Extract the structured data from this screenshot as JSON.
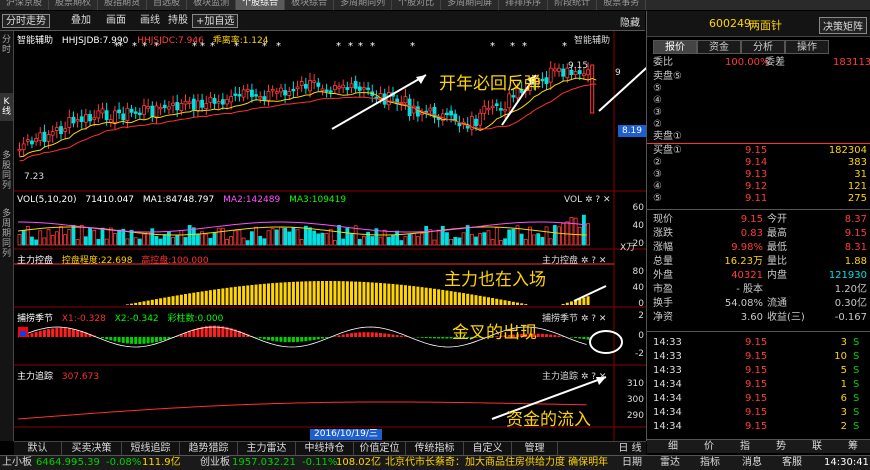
{
  "topnav": [
    "沪深京股",
    "股票期权",
    "股指期货",
    "自选股",
    "板块监测",
    "个股综合",
    "板块综合",
    "多周期同列",
    "个股对比",
    "多周期同屏",
    "排排序序",
    "阶段统计",
    "股票事务"
  ],
  "topnav_active": 5,
  "toolbar": {
    "items": [
      "分时走势",
      "叠加",
      "画面",
      "画线",
      "持股",
      "+加自选"
    ],
    "hide": "隐藏"
  },
  "leftbar": [
    "分时",
    "K线",
    "多股同列",
    "多周期同列"
  ],
  "main_panel": {
    "title": "智能辅助",
    "ma_lines": [
      {
        "label": "HHJSJDB:7.990",
        "color": "#ffffff"
      },
      {
        "label": "HHJSJDC:7.946",
        "color": "#ff4040"
      },
      {
        "label": "乖离率:1.124",
        "color": "#ffd400"
      }
    ],
    "right_title": "智能辅助",
    "high_label": "9.15",
    "low_label": "7.23",
    "price_tag": "8.19",
    "scale_label": "9"
  },
  "vol_panel": {
    "title": "VOL(5,10,20)",
    "items": [
      {
        "label": "71410.047",
        "color": "#ffffff"
      },
      {
        "label": "MA1:84748.797",
        "color": "#ffffff"
      },
      {
        "label": "MA2:142489",
        "color": "#ff50ff"
      },
      {
        "label": "MA3:109419",
        "color": "#00ff00"
      }
    ],
    "axis": [
      "60",
      "40",
      "20"
    ],
    "unit": "X万",
    "icons": "VOL ✲ ? ✕"
  },
  "force_panel": {
    "title": "主力控盘",
    "items": [
      {
        "label": "控盘程度:22.698",
        "color": "#ffd400"
      },
      {
        "label": "高控盘:100.000",
        "color": "#ff3030"
      }
    ],
    "axis": [
      "80",
      "40",
      "0"
    ],
    "icons": "主力控盘 ✲ ? ✕"
  },
  "season_panel": {
    "title": "捕捞季节",
    "items": [
      {
        "label": "X1:-0.328",
        "color": "#ff3030"
      },
      {
        "label": "X2:-0.342",
        "color": "#00ff00"
      },
      {
        "label": "彩柱数:0.000",
        "color": "#00ff00"
      }
    ],
    "axis": [
      "2",
      "0",
      "-2"
    ],
    "icons": "捕捞季节 ✲ ? ✕"
  },
  "track_panel": {
    "title": "主力追踪",
    "items": [
      {
        "label": "307.673",
        "color": "#ff3030"
      }
    ],
    "axis": [
      "310",
      "300",
      "290"
    ],
    "icons": "主力追踪 ✲ ? ✕"
  },
  "date_label": "2016/10/19/三",
  "annotations": [
    "开年必回反弹",
    "主力也在入场",
    "金叉的出现",
    "资金的流入"
  ],
  "right_panel": {
    "code": "600249",
    "name": "两面针",
    "decision_btn": "决策矩阵",
    "tabs": [
      "报价",
      "资金",
      "分析",
      "操作"
    ],
    "weibi_label": "委比",
    "weibi": "100.00%",
    "weicha_label": "委差",
    "weicha": "183113",
    "sell": [
      {
        "label": "卖盘⑤",
        "price": "",
        "vol": ""
      },
      {
        "label": "⑤",
        "price": "",
        "vol": ""
      },
      {
        "label": "④",
        "price": "",
        "vol": ""
      },
      {
        "label": "③",
        "price": "",
        "vol": ""
      },
      {
        "label": "②",
        "price": "",
        "vol": ""
      },
      {
        "label": "卖盘①",
        "price": "",
        "vol": ""
      }
    ],
    "buy": [
      {
        "label": "买盘①",
        "price": "9.15",
        "vol": "182304"
      },
      {
        "label": "②",
        "price": "9.14",
        "vol": "383"
      },
      {
        "label": "③",
        "price": "9.13",
        "vol": "31"
      },
      {
        "label": "④",
        "price": "9.12",
        "vol": "121"
      },
      {
        "label": "⑤",
        "price": "9.11",
        "vol": "275"
      }
    ],
    "quote": [
      {
        "l1": "现价",
        "v1": "9.15",
        "l2": "今开",
        "v2": "8.37",
        "c1": "#ff3b3b",
        "c2": "#ff3b3b"
      },
      {
        "l1": "涨跌",
        "v1": "0.83",
        "l2": "最高",
        "v2": "9.15",
        "c1": "#ff3b3b",
        "c2": "#ff3b3b"
      },
      {
        "l1": "涨幅",
        "v1": "9.98%",
        "l2": "最低",
        "v2": "8.31",
        "c1": "#ff3b3b",
        "c2": "#ff3b3b"
      },
      {
        "l1": "总量",
        "v1": "16.23万",
        "l2": "量比",
        "v2": "1.88",
        "c1": "#ffd400",
        "c2": "#ffd400"
      },
      {
        "l1": "外盘",
        "v1": "40321",
        "l2": "内盘",
        "v2": "121930",
        "c1": "#ff3b3b",
        "c2": "#00e0e0"
      },
      {
        "l1": "市盈",
        "v1": "- 股本",
        "l2": "",
        "v2": "1.20亿",
        "c1": "#c8c8c8",
        "c2": "#c8c8c8"
      },
      {
        "l1": "换手",
        "v1": "54.08%",
        "l2": "流通",
        "v2": "0.30亿",
        "c1": "#c8c8c8",
        "c2": "#c8c8c8"
      },
      {
        "l1": "净资",
        "v1": "3.60",
        "l2": "收益(三)",
        "v2": "-0.167",
        "c1": "#c8c8c8",
        "c2": "#c8c8c8"
      }
    ],
    "ticks": [
      {
        "time": "14:33",
        "price": "9.15",
        "vol": "3",
        "dir": "S"
      },
      {
        "time": "14:33",
        "price": "9.15",
        "vol": "10",
        "dir": "S"
      },
      {
        "time": "14:33",
        "price": "9.15",
        "vol": "5",
        "dir": "S"
      },
      {
        "time": "14:34",
        "price": "9.15",
        "vol": "1",
        "dir": "S"
      },
      {
        "time": "14:34",
        "price": "9.15",
        "vol": "6",
        "dir": "S"
      },
      {
        "time": "14:34",
        "price": "9.15",
        "vol": "3",
        "dir": "S"
      },
      {
        "time": "14:34",
        "price": "9.15",
        "vol": "2",
        "dir": "S"
      }
    ],
    "bottom_tabs": [
      "细",
      "价",
      "指",
      "势",
      "联",
      "筹"
    ]
  },
  "bottom_tabs": [
    "默认",
    "买卖决策",
    "短线追踪",
    "趋势猎踪",
    "主力雷达",
    "中线持仓",
    "价值定位",
    "传统指标",
    "自定义",
    "管理"
  ],
  "bottom_right": "日 线",
  "status": {
    "index1_name": "上小板",
    "index1_val": "6464.99",
    "index1_chg": "-5.39",
    "index1_pct": "-0.08%",
    "index1_amt": "111.9亿",
    "index2_name": "创业板",
    "index2_val": "1957.03",
    "index2_chg": "-2.21",
    "index2_pct": "-0.11%",
    "index2_amt": "108.02亿",
    "news": "北京代市长蔡奇：加大商品住房供给力度 确保明年",
    "right": [
      "日期",
      "雷达",
      "指标",
      "消息",
      "客服",
      "14:30:41"
    ]
  }
}
